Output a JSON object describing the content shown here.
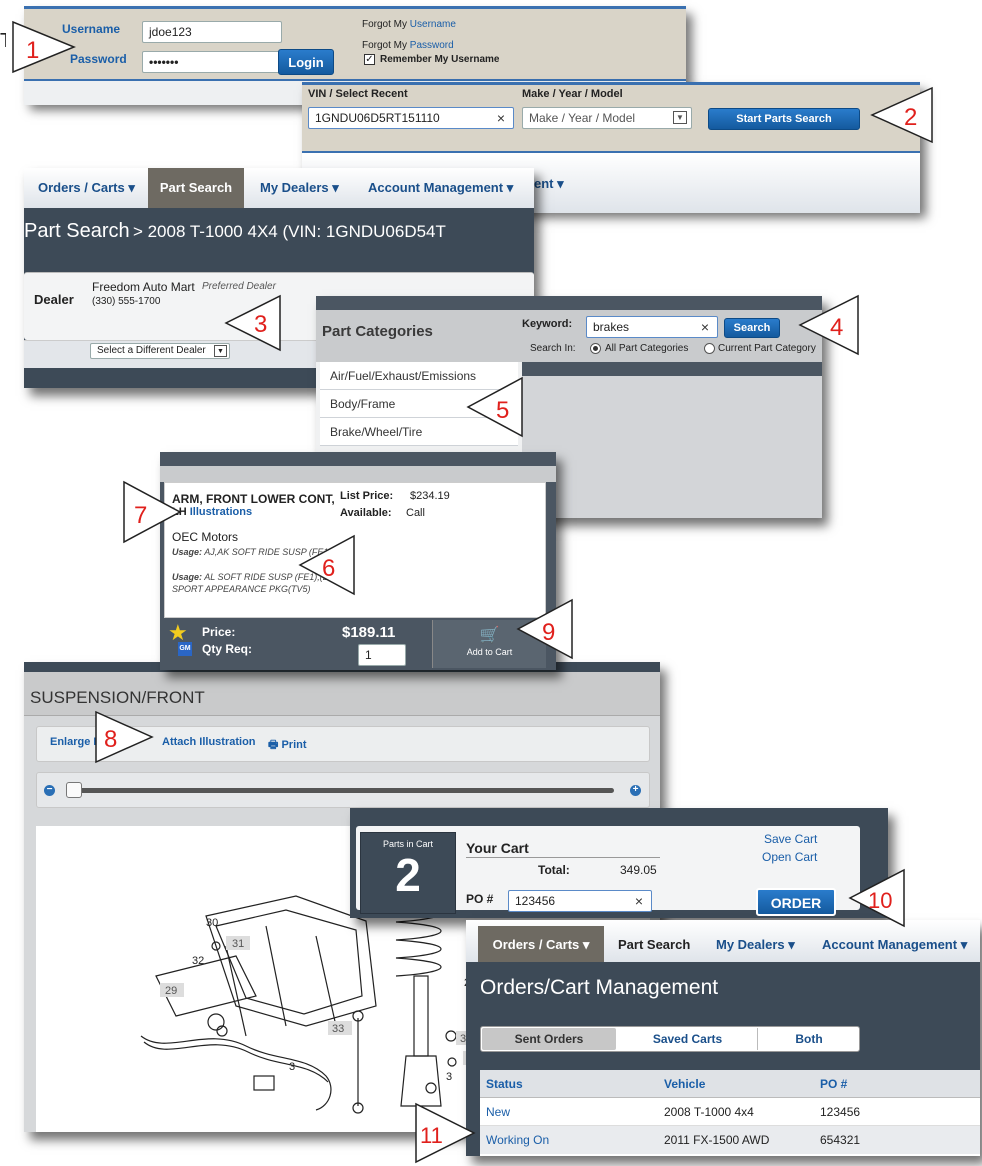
{
  "callouts": [
    "1",
    "2",
    "3",
    "4",
    "5",
    "6",
    "7",
    "8",
    "9",
    "10",
    "11"
  ],
  "login": {
    "username_label": "Username",
    "username_value": "jdoe123",
    "password_label": "Password",
    "password_value": "•••••••",
    "forgot_my": "Forgot My",
    "forgot_username": "Username",
    "forgot_password": "Password",
    "remember": "Remember My Username",
    "login_button": "Login"
  },
  "vin": {
    "vin_label": "VIN / Select Recent",
    "vin_value": "1GNDU06D5RT151110",
    "mym_label": "Make / Year / Model",
    "mym_value": "Make / Year / Model",
    "start_button": "Start Parts Search",
    "nav_fragment": "ent"
  },
  "nav": {
    "orders_carts": "Orders / Carts",
    "part_search": "Part Search",
    "my_dealers": "My Dealers",
    "account_management": "Account Management"
  },
  "part_search": {
    "title": "Part Search",
    "subtitle": "> 2008 T-1000 4X4 (VIN: 1GNDU06D54T",
    "dealer_label": "Dealer",
    "dealer_name": "Freedom Auto Mart",
    "dealer_tag": "Preferred Dealer",
    "dealer_phone": "(330) 555-1700",
    "select_dealer": "Select a Different Dealer"
  },
  "categories": {
    "header": "Part Categories",
    "keyword_label": "Keyword:",
    "keyword_value": "brakes",
    "search_button": "Search",
    "search_in_label": "Search In:",
    "option_all": "All Part Categories",
    "option_current": "Current Part Category",
    "items": [
      "Air/Fuel/Exhaust/Emissions",
      "Body/Frame",
      "Brake/Wheel/Tire"
    ]
  },
  "part_card": {
    "name_line1": "ARM, FRONT LOWER CONT,",
    "name_line2_prefix": "LH",
    "illustrations_link": "Illustrations",
    "list_price_label": "List Price:",
    "list_price_value": "$234.19",
    "available_label": "Available:",
    "available_value": "Call",
    "brand": "OEC Motors",
    "usage1_label": "Usage:",
    "usage1_text": "AJ,AK SOFT RIDE SUSP (FE1)",
    "usage2_label": "Usage:",
    "usage2_text": "AL SOFT RIDE SUSP (FE1),(EXC SPORT APPEARANCE PKG(TV5)",
    "price_label": "Price:",
    "price_value": "$189.11",
    "qty_label": "Qty Req:",
    "qty_value": "1",
    "add_to_cart": "Add to Cart",
    "gm_badge": "GM"
  },
  "illustration": {
    "title": "SUSPENSION/FRONT",
    "enlarge": "Enlarge I",
    "attach": "Attach Illustration",
    "print": "Print",
    "zoom_level": 0.05,
    "part_numbers": [
      "30",
      "31",
      "32",
      "29",
      "33",
      "2",
      "3",
      "3",
      "4",
      "3"
    ]
  },
  "cart": {
    "parts_in_cart_label": "Parts in Cart",
    "count": "2",
    "title": "Your Cart",
    "total_label": "Total:",
    "total_value": "349.05",
    "save_cart": "Save Cart",
    "open_cart": "Open Cart",
    "po_label": "PO #",
    "po_value": "123456",
    "order_button": "ORDER"
  },
  "orders": {
    "title": "Orders/Cart Management",
    "tabs": [
      "Sent Orders",
      "Saved Carts",
      "Both"
    ],
    "columns": [
      "Status",
      "Vehicle",
      "PO #"
    ],
    "rows": [
      {
        "status": "New",
        "vehicle": "2008 T-1000 4x4",
        "po": "123456"
      },
      {
        "status": "Working On",
        "vehicle": "2011 FX-1500 AWD",
        "po": "654321"
      }
    ]
  },
  "colors": {
    "accent_blue": "#1a5ea8",
    "dark_header": "#3d4a57",
    "active_tab": "#6e6a62",
    "callout_red": "#e0201c"
  }
}
